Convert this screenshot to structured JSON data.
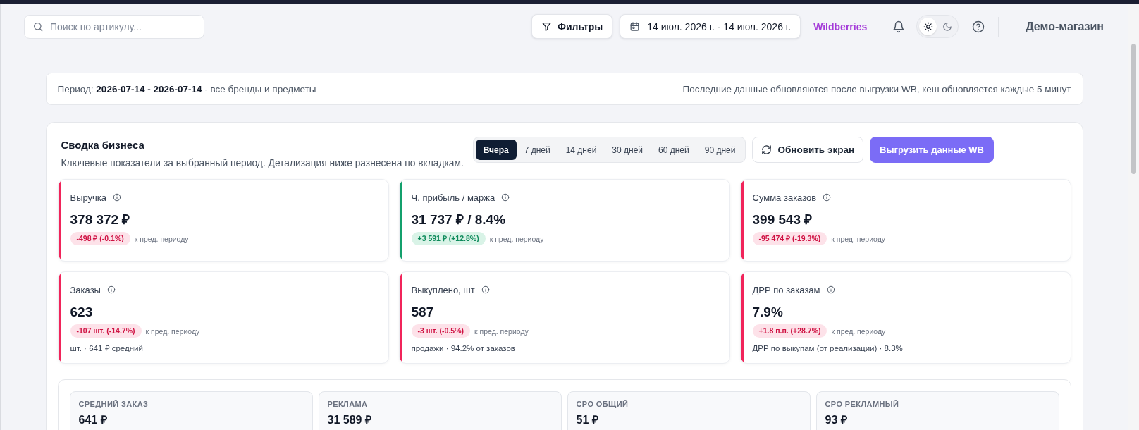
{
  "header": {
    "search": {
      "placeholder": "Поиск по артикулу..."
    },
    "filters_button": "Фильтры",
    "date_range": "14 июл. 2026 г. - 14 июл. 2026 г.",
    "marketplace": "Wildberries",
    "theme_toggle": [
      {
        "kind": "light",
        "selected": true
      },
      {
        "kind": "dark",
        "selected": false
      }
    ],
    "store": "Демо-магазин"
  },
  "period_bar": {
    "text": "Период: **2026-07-14 - 2026-07-14** - все бренды и предметы",
    "note": "Последние данные обновляются после выгрузки WB, кеш обновляется каждые 5 минут"
  },
  "summary": {
    "title": "Сводка бизнеса",
    "subtitle": "Ключевые показатели за выбранный период. Детализация ниже разнесена по вкладкам.",
    "period_tabs": [
      {
        "label": "Вчера",
        "selected": true
      },
      {
        "label": "7 дней",
        "selected": false
      },
      {
        "label": "14 дней",
        "selected": false
      },
      {
        "label": "30 дней",
        "selected": false
      },
      {
        "label": "60 дней",
        "selected": false
      },
      {
        "label": "90 дней",
        "selected": false
      }
    ],
    "buttons": [
      {
        "kind": "refresh",
        "label": "Обновить экран"
      },
      {
        "kind": "export",
        "label": "Выгрузить данные WB"
      }
    ],
    "metrics": [
      {
        "title": "Выручка",
        "value": "378 372 ₽",
        "delta": "-498 ₽ (-0.1%)",
        "favorable": false,
        "comparison": "к пред. периоду"
      },
      {
        "title": "Ч. прибыль / маржа",
        "value": "31 737 ₽ / 8.4%",
        "delta": "+3 591 ₽ (+12.8%)",
        "favorable": true,
        "comparison": "к пред. периоду"
      },
      {
        "title": "Сумма заказов",
        "value": "399 543 ₽",
        "delta": "-95 474 ₽ (-19.3%)",
        "favorable": false,
        "comparison": "к пред. периоду"
      },
      {
        "title": "Заказы",
        "value": "623",
        "delta": "-107 шт. (-14.7%)",
        "favorable": false,
        "comparison": "к пред. периоду",
        "note": "шт. · 641 ₽ средний"
      },
      {
        "title": "Выкуплено, шт",
        "value": "587",
        "delta": "-3 шт. (-0.5%)",
        "favorable": false,
        "comparison": "к пред. периоду",
        "note": "продажи · 94.2% от заказов"
      },
      {
        "title": "ДРР по заказам",
        "value": "7.9%",
        "delta": "+1.8 п.п. (+28.7%)",
        "favorable": false,
        "comparison": "к пред. периоду",
        "note": "ДРР по выкупам (от реализации) · 8.3%"
      }
    ],
    "stats": [
      {
        "label": "СРЕДНИЙ ЗАКАЗ",
        "value": "641 ₽"
      },
      {
        "label": "РЕКЛАМА",
        "value": "31 589 ₽"
      },
      {
        "label": "СРО ОБЩИЙ",
        "value": "51 ₽"
      },
      {
        "label": "СРО РЕКЛАМНЫЙ",
        "value": "93 ₽"
      }
    ]
  }
}
